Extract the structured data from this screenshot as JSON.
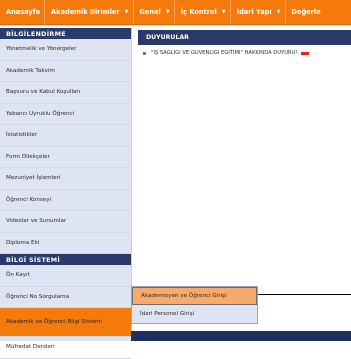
{
  "topbar": {
    "items": [
      {
        "label": "Anasayfa",
        "dropdown": false
      },
      {
        "label": "Akademik Birimler",
        "dropdown": true
      },
      {
        "label": "Genel",
        "dropdown": true
      },
      {
        "label": "İç Kontrol",
        "dropdown": true
      },
      {
        "label": "İdari Yapı",
        "dropdown": true
      },
      {
        "label": "Değerle",
        "dropdown": false
      }
    ],
    "caret": "▼"
  },
  "sidebar": {
    "section1_title": "BİLGİLENDİRME",
    "section1_items": [
      "Yönetmelik ve Yönergeler",
      "Akademik Takvim",
      "Başvuru ve Kabul Koşulları",
      "Yabancı Uyruklu Öğrenci",
      "İstatistikler",
      "Form Dilekçeler",
      "Mezuniyet İşlemleri",
      "Öğrenci Konseyi",
      "Videolar ve Sunumlar",
      "Diploma Eki"
    ],
    "section2_title": "BİLGİ SİSTEMİ",
    "section2_items": [
      "Ön Kayıt",
      "Öğrenci No Sorgulama",
      "Akademik ve Öğrenci Bilgi Sistemi",
      "Müfredat Dersleri"
    ]
  },
  "main": {
    "title": "DUYURULAR",
    "announcement": "\"İŞ SAĞLIĞI VE GÜVENLİĞİ EĞİTİMİ\" HAKKINDA DUYURU!"
  },
  "dropdown": {
    "items": [
      "Akademisyen ve Öğrenci Girişi",
      "İdari Personel Girişi"
    ]
  },
  "colors": {
    "accent_orange": "#f47a0c",
    "navy": "#2a3a6a",
    "sidebar_bg": "#dfe4f2"
  }
}
